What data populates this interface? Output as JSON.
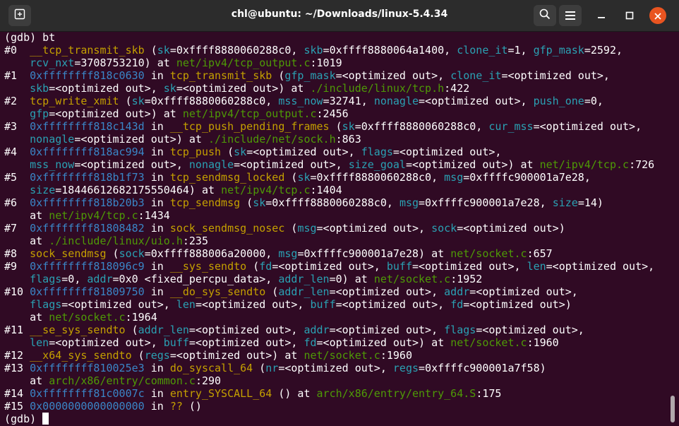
{
  "window": {
    "title": "chl@ubuntu: ~/Downloads/linux-5.4.34",
    "buttons": {
      "new_tab_icon": "new-tab-icon",
      "search_icon": "search-icon",
      "menu_icon": "hamburger-menu-icon",
      "minimize_icon": "minimize-icon",
      "maximize_icon": "maximize-icon",
      "close_icon": "close-icon"
    }
  },
  "colors": {
    "background": "#300a24",
    "titlebar": "#2c2c2c",
    "address": "#3a86c7",
    "function": "#c4a000",
    "parameter": "#2aa1b3",
    "path": "#4e9a06",
    "close_button": "#e95420"
  },
  "terminal": {
    "lines": [
      [
        [
          "plain",
          "(gdb) bt"
        ]
      ],
      [
        [
          "frameno",
          "#0  "
        ],
        [
          "func",
          "__tcp_transmit_skb"
        ],
        [
          "plain",
          " ("
        ],
        [
          "param",
          "sk"
        ],
        [
          "plain",
          "=0xffff8880060288c0, "
        ],
        [
          "param",
          "skb"
        ],
        [
          "plain",
          "=0xffff8880064a1400, "
        ],
        [
          "param",
          "clone_it"
        ],
        [
          "plain",
          "=1, "
        ],
        [
          "param",
          "gfp_mask"
        ],
        [
          "plain",
          "=2592,"
        ]
      ],
      [
        [
          "plain",
          "    "
        ],
        [
          "param",
          "rcv_nxt"
        ],
        [
          "plain",
          "=3708753210) at "
        ],
        [
          "path",
          "net/ipv4/tcp_output.c"
        ],
        [
          "plain",
          ":1019"
        ]
      ],
      [
        [
          "frameno",
          "#1  "
        ],
        [
          "addr",
          "0xffffffff818c0630"
        ],
        [
          "plain",
          " in "
        ],
        [
          "func",
          "tcp_transmit_skb"
        ],
        [
          "plain",
          " ("
        ],
        [
          "param",
          "gfp_mask"
        ],
        [
          "plain",
          "=<optimized out>, "
        ],
        [
          "param",
          "clone_it"
        ],
        [
          "plain",
          "=<optimized out>,"
        ]
      ],
      [
        [
          "plain",
          "    "
        ],
        [
          "param",
          "skb"
        ],
        [
          "plain",
          "=<optimized out>, "
        ],
        [
          "param",
          "sk"
        ],
        [
          "plain",
          "=<optimized out>) at "
        ],
        [
          "path",
          "./include/linux/tcp.h"
        ],
        [
          "plain",
          ":422"
        ]
      ],
      [
        [
          "frameno",
          "#2  "
        ],
        [
          "func",
          "tcp_write_xmit"
        ],
        [
          "plain",
          " ("
        ],
        [
          "param",
          "sk"
        ],
        [
          "plain",
          "=0xffff8880060288c0, "
        ],
        [
          "param",
          "mss_now"
        ],
        [
          "plain",
          "=32741, "
        ],
        [
          "param",
          "nonagle"
        ],
        [
          "plain",
          "=<optimized out>, "
        ],
        [
          "param",
          "push_one"
        ],
        [
          "plain",
          "=0,"
        ]
      ],
      [
        [
          "plain",
          "    "
        ],
        [
          "param",
          "gfp"
        ],
        [
          "plain",
          "=<optimized out>) at "
        ],
        [
          "path",
          "net/ipv4/tcp_output.c"
        ],
        [
          "plain",
          ":2456"
        ]
      ],
      [
        [
          "frameno",
          "#3  "
        ],
        [
          "addr",
          "0xffffffff818c143d"
        ],
        [
          "plain",
          " in "
        ],
        [
          "func",
          "__tcp_push_pending_frames"
        ],
        [
          "plain",
          " ("
        ],
        [
          "param",
          "sk"
        ],
        [
          "plain",
          "=0xffff8880060288c0, "
        ],
        [
          "param",
          "cur_mss"
        ],
        [
          "plain",
          "=<optimized out>,"
        ]
      ],
      [
        [
          "plain",
          "    "
        ],
        [
          "param",
          "nonagle"
        ],
        [
          "plain",
          "=<optimized out>) at "
        ],
        [
          "path",
          "./include/net/sock.h"
        ],
        [
          "plain",
          ":863"
        ]
      ],
      [
        [
          "frameno",
          "#4  "
        ],
        [
          "addr",
          "0xffffffff818ac994"
        ],
        [
          "plain",
          " in "
        ],
        [
          "func",
          "tcp_push"
        ],
        [
          "plain",
          " ("
        ],
        [
          "param",
          "sk"
        ],
        [
          "plain",
          "=<optimized out>, "
        ],
        [
          "param",
          "flags"
        ],
        [
          "plain",
          "=<optimized out>,"
        ]
      ],
      [
        [
          "plain",
          "    "
        ],
        [
          "param",
          "mss_now"
        ],
        [
          "plain",
          "=<optimized out>, "
        ],
        [
          "param",
          "nonagle"
        ],
        [
          "plain",
          "=<optimized out>, "
        ],
        [
          "param",
          "size_goal"
        ],
        [
          "plain",
          "=<optimized out>) at "
        ],
        [
          "path",
          "net/ipv4/tcp.c"
        ],
        [
          "plain",
          ":726"
        ]
      ],
      [
        [
          "frameno",
          "#5  "
        ],
        [
          "addr",
          "0xffffffff818b1f73"
        ],
        [
          "plain",
          " in "
        ],
        [
          "func",
          "tcp_sendmsg_locked"
        ],
        [
          "plain",
          " ("
        ],
        [
          "param",
          "sk"
        ],
        [
          "plain",
          "=0xffff8880060288c0, "
        ],
        [
          "param",
          "msg"
        ],
        [
          "plain",
          "=0xffffc900001a7e28,"
        ]
      ],
      [
        [
          "plain",
          "    "
        ],
        [
          "param",
          "size"
        ],
        [
          "plain",
          "=18446612682175550464) at "
        ],
        [
          "path",
          "net/ipv4/tcp.c"
        ],
        [
          "plain",
          ":1404"
        ]
      ],
      [
        [
          "frameno",
          "#6  "
        ],
        [
          "addr",
          "0xffffffff818b20b3"
        ],
        [
          "plain",
          " in "
        ],
        [
          "func",
          "tcp_sendmsg"
        ],
        [
          "plain",
          " ("
        ],
        [
          "param",
          "sk"
        ],
        [
          "plain",
          "=0xffff8880060288c0, "
        ],
        [
          "param",
          "msg"
        ],
        [
          "plain",
          "=0xffffc900001a7e28, "
        ],
        [
          "param",
          "size"
        ],
        [
          "plain",
          "=14)"
        ]
      ],
      [
        [
          "plain",
          "    at "
        ],
        [
          "path",
          "net/ipv4/tcp.c"
        ],
        [
          "plain",
          ":1434"
        ]
      ],
      [
        [
          "frameno",
          "#7  "
        ],
        [
          "addr",
          "0xffffffff81808482"
        ],
        [
          "plain",
          " in "
        ],
        [
          "func",
          "sock_sendmsg_nosec"
        ],
        [
          "plain",
          " ("
        ],
        [
          "param",
          "msg"
        ],
        [
          "plain",
          "=<optimized out>, "
        ],
        [
          "param",
          "sock"
        ],
        [
          "plain",
          "=<optimized out>)"
        ]
      ],
      [
        [
          "plain",
          "    at "
        ],
        [
          "path",
          "./include/linux/uio.h"
        ],
        [
          "plain",
          ":235"
        ]
      ],
      [
        [
          "frameno",
          "#8  "
        ],
        [
          "func",
          "sock_sendmsg"
        ],
        [
          "plain",
          " ("
        ],
        [
          "param",
          "sock"
        ],
        [
          "plain",
          "=0xffff888006a20000, "
        ],
        [
          "param",
          "msg"
        ],
        [
          "plain",
          "=0xffffc900001a7e28) at "
        ],
        [
          "path",
          "net/socket.c"
        ],
        [
          "plain",
          ":657"
        ]
      ],
      [
        [
          "frameno",
          "#9  "
        ],
        [
          "addr",
          "0xffffffff818096c9"
        ],
        [
          "plain",
          " in "
        ],
        [
          "func",
          "__sys_sendto"
        ],
        [
          "plain",
          " ("
        ],
        [
          "param",
          "fd"
        ],
        [
          "plain",
          "=<optimized out>, "
        ],
        [
          "param",
          "buff"
        ],
        [
          "plain",
          "=<optimized out>, "
        ],
        [
          "param",
          "len"
        ],
        [
          "plain",
          "=<optimized out>,"
        ]
      ],
      [
        [
          "plain",
          "    "
        ],
        [
          "param",
          "flags"
        ],
        [
          "plain",
          "=0, "
        ],
        [
          "param",
          "addr"
        ],
        [
          "plain",
          "=0x0 <fixed_percpu_data>, "
        ],
        [
          "param",
          "addr_len"
        ],
        [
          "plain",
          "=0) at "
        ],
        [
          "path",
          "net/socket.c"
        ],
        [
          "plain",
          ":1952"
        ]
      ],
      [
        [
          "frameno",
          "#10 "
        ],
        [
          "addr",
          "0xffffffff81809750"
        ],
        [
          "plain",
          " in "
        ],
        [
          "func",
          "__do_sys_sendto"
        ],
        [
          "plain",
          " ("
        ],
        [
          "param",
          "addr_len"
        ],
        [
          "plain",
          "=<optimized out>, "
        ],
        [
          "param",
          "addr"
        ],
        [
          "plain",
          "=<optimized out>,"
        ]
      ],
      [
        [
          "plain",
          "    "
        ],
        [
          "param",
          "flags"
        ],
        [
          "plain",
          "=<optimized out>, "
        ],
        [
          "param",
          "len"
        ],
        [
          "plain",
          "=<optimized out>, "
        ],
        [
          "param",
          "buff"
        ],
        [
          "plain",
          "=<optimized out>, "
        ],
        [
          "param",
          "fd"
        ],
        [
          "plain",
          "=<optimized out>)"
        ]
      ],
      [
        [
          "plain",
          "    at "
        ],
        [
          "path",
          "net/socket.c"
        ],
        [
          "plain",
          ":1964"
        ]
      ],
      [
        [
          "frameno",
          "#11 "
        ],
        [
          "func",
          "__se_sys_sendto"
        ],
        [
          "plain",
          " ("
        ],
        [
          "param",
          "addr_len"
        ],
        [
          "plain",
          "=<optimized out>, "
        ],
        [
          "param",
          "addr"
        ],
        [
          "plain",
          "=<optimized out>, "
        ],
        [
          "param",
          "flags"
        ],
        [
          "plain",
          "=<optimized out>,"
        ]
      ],
      [
        [
          "plain",
          "    "
        ],
        [
          "param",
          "len"
        ],
        [
          "plain",
          "=<optimized out>, "
        ],
        [
          "param",
          "buff"
        ],
        [
          "plain",
          "=<optimized out>, "
        ],
        [
          "param",
          "fd"
        ],
        [
          "plain",
          "=<optimized out>) at "
        ],
        [
          "path",
          "net/socket.c"
        ],
        [
          "plain",
          ":1960"
        ]
      ],
      [
        [
          "frameno",
          "#12 "
        ],
        [
          "func",
          "__x64_sys_sendto"
        ],
        [
          "plain",
          " ("
        ],
        [
          "param",
          "regs"
        ],
        [
          "plain",
          "=<optimized out>) at "
        ],
        [
          "path",
          "net/socket.c"
        ],
        [
          "plain",
          ":1960"
        ]
      ],
      [
        [
          "frameno",
          "#13 "
        ],
        [
          "addr",
          "0xffffffff810025e3"
        ],
        [
          "plain",
          " in "
        ],
        [
          "func",
          "do_syscall_64"
        ],
        [
          "plain",
          " ("
        ],
        [
          "param",
          "nr"
        ],
        [
          "plain",
          "=<optimized out>, "
        ],
        [
          "param",
          "regs"
        ],
        [
          "plain",
          "=0xffffc900001a7f58)"
        ]
      ],
      [
        [
          "plain",
          "    at "
        ],
        [
          "path",
          "arch/x86/entry/common.c"
        ],
        [
          "plain",
          ":290"
        ]
      ],
      [
        [
          "frameno",
          "#14 "
        ],
        [
          "addr",
          "0xffffffff81c0007c"
        ],
        [
          "plain",
          " in "
        ],
        [
          "func",
          "entry_SYSCALL_64"
        ],
        [
          "plain",
          " () at "
        ],
        [
          "path",
          "arch/x86/entry/entry_64.S"
        ],
        [
          "plain",
          ":175"
        ]
      ],
      [
        [
          "frameno",
          "#15 "
        ],
        [
          "addr",
          "0x0000000000000000"
        ],
        [
          "plain",
          " in "
        ],
        [
          "func",
          "??"
        ],
        [
          "plain",
          " ()"
        ]
      ]
    ],
    "prompt": "(gdb) "
  }
}
